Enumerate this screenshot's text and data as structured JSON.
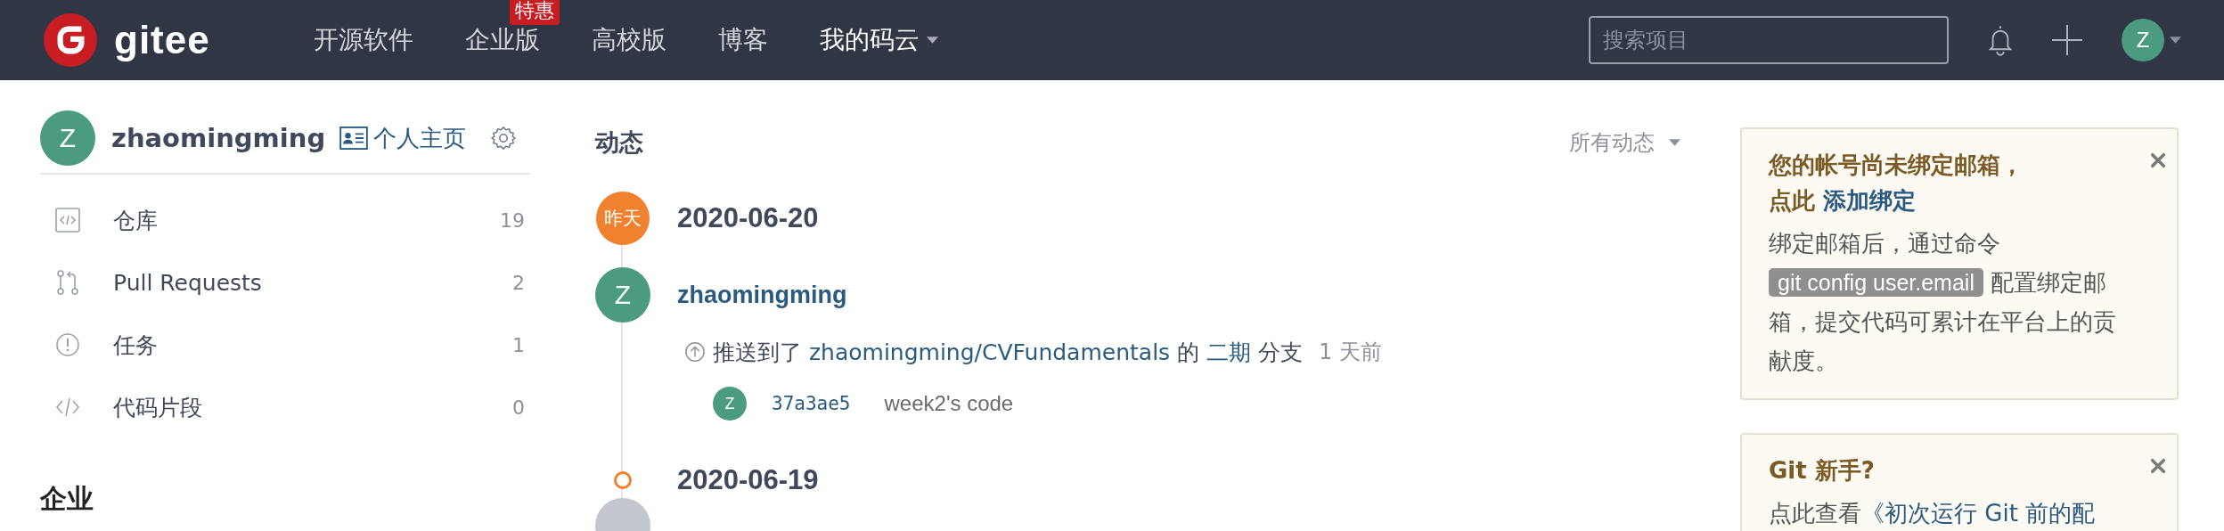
{
  "navbar": {
    "logo_text": "gitee",
    "items": [
      {
        "label": "开源软件",
        "selected": false,
        "has_menu": false
      },
      {
        "label": "企业版",
        "selected": false,
        "has_menu": false,
        "badge": "特惠"
      },
      {
        "label": "高校版",
        "selected": false,
        "has_menu": false
      },
      {
        "label": "博客",
        "selected": false,
        "has_menu": false
      },
      {
        "label": "我的码云",
        "selected": true,
        "has_menu": true
      }
    ],
    "search": {
      "placeholder": "搜索项目"
    },
    "avatar_letter": "Z"
  },
  "sidebar": {
    "user": {
      "avatar_letter": "Z",
      "name": "zhaomingming",
      "profile_link": "个人主页"
    },
    "items": [
      {
        "kind": "repo",
        "label": "仓库",
        "count": "19"
      },
      {
        "kind": "pull",
        "label": "Pull Requests",
        "count": "2"
      },
      {
        "kind": "issue",
        "label": "任务",
        "count": "1"
      },
      {
        "kind": "snippet",
        "label": "代码片段",
        "count": "0"
      }
    ],
    "section_title": "企业"
  },
  "feed": {
    "title": "动态",
    "filter": "所有动态",
    "days": [
      {
        "marker": {
          "kind": "badge",
          "label": "昨天"
        },
        "date": "2020-06-20",
        "events": [
          {
            "kind": "push",
            "avatar_letter": "Z",
            "user": "zhaomingming",
            "verb": "推送到了",
            "repo": "zhaomingming/CVFundamentals",
            "of": "的",
            "branch": "二期",
            "branch_word": "分支",
            "time": "1 天前",
            "commits": [
              {
                "avatar_letter": "Z",
                "hash": "37a3ae5",
                "message": "week2's code"
              }
            ]
          }
        ]
      },
      {
        "marker": {
          "kind": "ring"
        },
        "date": "2020-06-19",
        "events": [
          {
            "kind": "partial"
          }
        ]
      }
    ]
  },
  "notices": [
    {
      "title": "您的帐号尚未绑定邮箱，",
      "title_prefix": "点此",
      "title_link": "添加绑定",
      "body_before": "绑定邮箱后，通过命令",
      "code": "git config user.email",
      "body_after": "配置绑定邮箱，提交代码可累计在平台上的贡献度。"
    },
    {
      "title": "Git 新手?",
      "body_before": "点此查看",
      "link": "《初次运行 Git 前的配"
    }
  ]
}
